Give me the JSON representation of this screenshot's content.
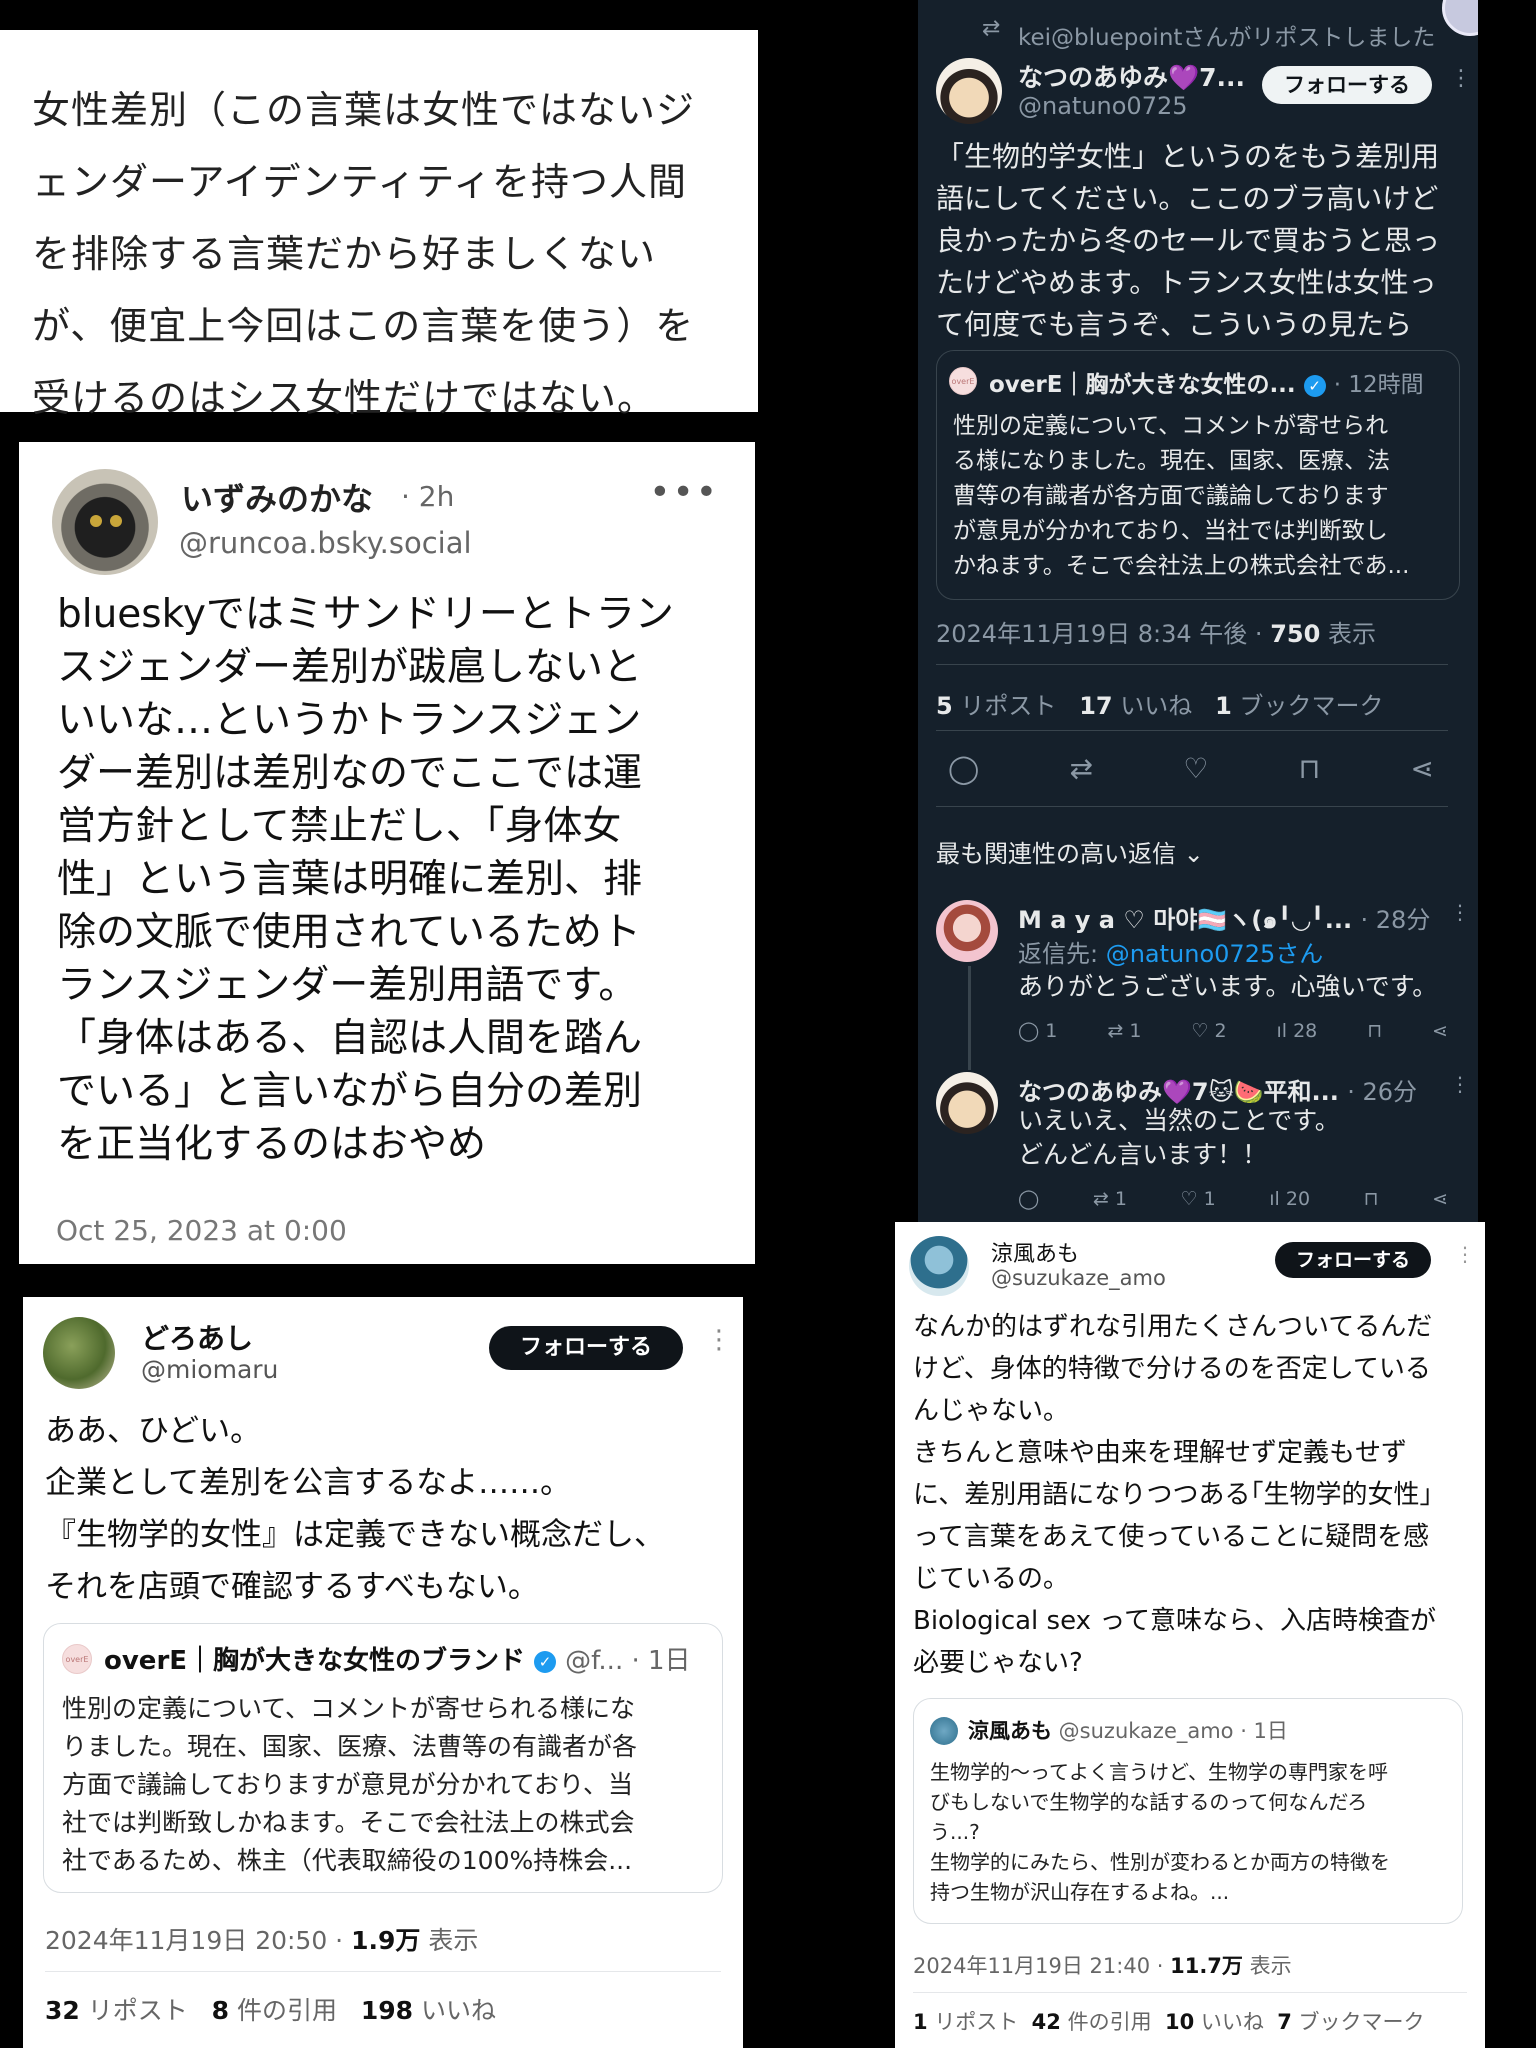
{
  "article_excerpt": {
    "lines": [
      "女性差別（この言葉は女性ではないジ",
      "ェンダーアイデンティティを持つ人間",
      "を排除する言葉だから好ましくない",
      "が、便宜上今回はこの言葉を使う）を",
      "受けるのはシス女性だけではない。"
    ]
  },
  "bluesky_post": {
    "name": "いずみのかな",
    "time": "· 2h",
    "handle": "@runcoa.bsky.social",
    "more": "•••",
    "body_lines": [
      "blueskyではミサンドリーとトラン",
      "スジェンダー差別が跋扈しないと",
      "いいな…というかトランスジェン",
      "ダー差別は差別なのでここでは運",
      "営方針として禁止だし、「身体女",
      "性」という言葉は明確に差別、排",
      "除の文脈で使用されているためト",
      "ランスジェンダー差別用語です。",
      "「身体はある、自認は人間を踏ん",
      "でいる」と言いながら自分の差別",
      "を正当化するのはおやめ"
    ],
    "date": "Oct 25, 2023 at 0:00"
  },
  "x_post_doroashi": {
    "name": "どろあし",
    "handle": "@miomaru",
    "follow_label": "フォローする",
    "kebab": "⋮",
    "body_lines": [
      "ああ、ひどい。",
      "企業として差別を公言するなよ……。",
      "『生物学的女性』は定義できない概念だし、",
      "それを店頭で確認するすべもない。"
    ],
    "quote": {
      "logo_text": "overE",
      "author": "overE｜胸が大きな女性のブランド",
      "verified": "✓",
      "handle_time": "@f... · 1日",
      "body_lines": [
        "性別の定義について、コメントが寄せられる様にな",
        "りました。現在、国家、医療、法曹等の有識者が各",
        "方面で議論しておりますが意見が分かれており、当",
        "社では判断致しかねます。そこで会社法上の株式会",
        "社であるため、株主（代表取締役の100%持株会..."
      ]
    },
    "timestamp": "2024年11月19日 20:50 · ",
    "views_count": "1.9万",
    "views_label": " 表示",
    "stats": [
      {
        "count": "32",
        "label": "リポスト"
      },
      {
        "count": "8",
        "label": "件の引用"
      },
      {
        "count": "198",
        "label": "いいね"
      }
    ]
  },
  "x_post_natsuno": {
    "repost_icon": "⇄",
    "repost_text": "kei@bluepointさんがリポストしました",
    "name": "なつのあゆみ💜7...",
    "handle": "@natuno0725",
    "follow_label": "フォローする",
    "kebab": "⋮",
    "body_lines": [
      "「生物的学女性」というのをもう差別用",
      "語にしてください。ここのブラ高いけど",
      "良かったから冬のセールで買おうと思っ",
      "たけどやめます。トランス女性は女性っ",
      "て何度でも言うぞ、こういうの見たら"
    ],
    "quote": {
      "logo_text": "overE",
      "author": "overE｜胸が大きな女性の...",
      "verified": "✓",
      "time": "· 12時間",
      "body_lines": [
        "性別の定義について、コメントが寄せられ",
        "る様になりました。現在、国家、医療、法",
        "曹等の有識者が各方面で議論しております",
        "が意見が分かれており、当社では判断致し",
        "かねます。そこで会社法上の株式会社であ..."
      ]
    },
    "timestamp": "2024年11月19日 8:34 午後 · ",
    "views_count": "750",
    "views_label": " 表示",
    "stats": [
      {
        "count": "5",
        "label": "リポスト"
      },
      {
        "count": "17",
        "label": "いいね"
      },
      {
        "count": "1",
        "label": "ブックマーク"
      }
    ],
    "actions": [
      "reply-icon",
      "repost-icon",
      "like-icon",
      "bookmark-icon",
      "share-icon"
    ],
    "action_glyphs": [
      "◯",
      "⇄",
      "♡",
      "⊓",
      "⋖"
    ],
    "sort_label": "最も関連性の高い返信 ⌄",
    "replies": [
      {
        "name": "M a y a ♡ 마야🏳️‍⚧️ヽ(๑╹◡╹... ",
        "time": "· 28分",
        "to_label": "返信先: ",
        "to_handle": "@natuno0725さん",
        "text_lines": [
          "ありがとうございます。心強いです。"
        ],
        "counts": {
          "reply": "◯ 1",
          "repost": "⇄ 1",
          "like": "♡ 2",
          "views": "ıl 28",
          "bookmark": "⊓",
          "share": "⋖"
        }
      },
      {
        "name": "なつのあゆみ💜7🐱🍉平和... ",
        "time": "· 26分",
        "text_lines": [
          "いえいえ、当然のことです。",
          "どんどん言います！！"
        ],
        "counts": {
          "reply": "◯",
          "repost": "⇄ 1",
          "like": "♡ 1",
          "views": "ıl 20",
          "bookmark": "⊓",
          "share": "⋖"
        }
      }
    ]
  },
  "x_post_suzukaze": {
    "name": "涼風あも",
    "handle": "@suzukaze_amo",
    "follow_label": "フォローする",
    "kebab": "⋮",
    "body_lines": [
      "なんか的はずれな引用たくさんついてるんだ",
      "けど、身体的特徴で分けるのを否定している",
      "んじゃない。",
      "きちんと意味や由来を理解せず定義もせず",
      "に、差別用語になりつつある｢生物学的女性｣",
      "って言葉をあえて使っていることに疑問を感",
      "じているの。",
      "Biological sex って意味なら、入店時検査が",
      "必要じゃない?"
    ],
    "quote": {
      "author": "涼風あも",
      "handle_time": " @suzukaze_amo · 1日",
      "body_lines": [
        "生物学的〜ってよく言うけど、生物学の専門家を呼",
        "びもしないで生物学的な話するのって何なんだろ",
        "う...?",
        "生物学的にみたら、性別が変わるとか両方の特徴を",
        "持つ生物が沢山存在するよね。..."
      ]
    },
    "timestamp": "2024年11月19日 21:40 · ",
    "views_count": "11.7万",
    "views_label": " 表示",
    "stats": [
      {
        "count": "1",
        "label": "リポスト"
      },
      {
        "count": "42",
        "label": "件の引用"
      },
      {
        "count": "10",
        "label": "いいね"
      },
      {
        "count": "7",
        "label": "ブックマーク"
      }
    ]
  }
}
